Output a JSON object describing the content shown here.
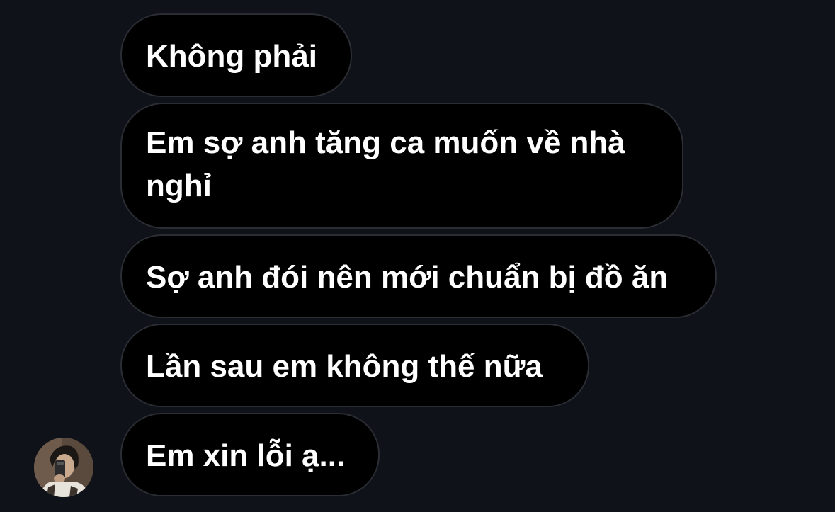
{
  "messages": [
    {
      "text": "Không phải"
    },
    {
      "text": "Em sợ anh tăng ca muốn về nhà nghỉ"
    },
    {
      "text": "Sợ anh đói nên mới chuẩn bị đồ ăn"
    },
    {
      "text": "Lần sau em không thế nữa"
    },
    {
      "text": "Em xin lỗi ạ..."
    }
  ],
  "colors": {
    "background": "#0f1218",
    "bubble": "#000000",
    "bubble_border": "#2a2d33",
    "text": "#ffffff"
  },
  "avatar": {
    "icon": "user-avatar-photo"
  }
}
